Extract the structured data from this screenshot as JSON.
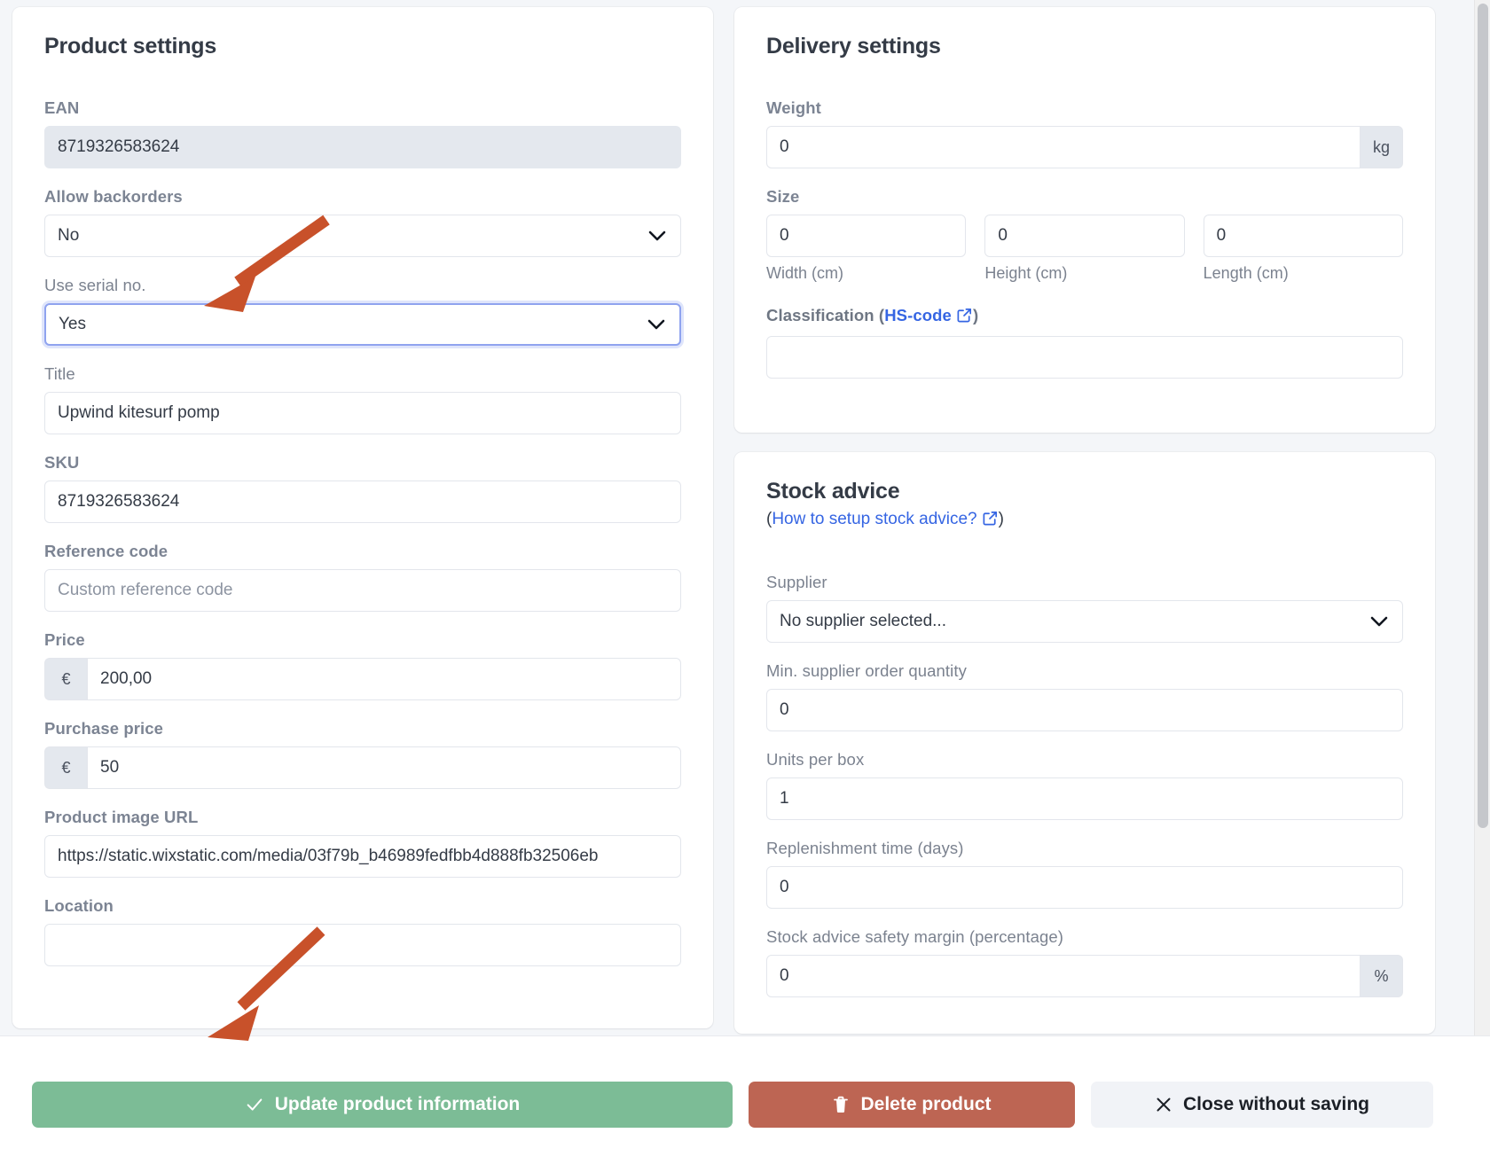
{
  "product_settings": {
    "title": "Product settings",
    "fields": {
      "ean": {
        "label": "EAN",
        "value": "8719326583624"
      },
      "allow_backorders": {
        "label": "Allow backorders",
        "value": "No"
      },
      "use_serial_no": {
        "label": "Use serial no.",
        "value": "Yes"
      },
      "title": {
        "label": "Title",
        "value": "Upwind kitesurf pomp"
      },
      "sku": {
        "label": "SKU",
        "value": "8719326583624"
      },
      "reference_code": {
        "label": "Reference code",
        "value": "",
        "placeholder": "Custom reference code"
      },
      "price": {
        "label": "Price",
        "currency": "€",
        "value": "200,00"
      },
      "purchase_price": {
        "label": "Purchase price",
        "currency": "€",
        "value": "50"
      },
      "product_image_url": {
        "label": "Product image URL",
        "value": "https://static.wixstatic.com/media/03f79b_b46989fedfbb4d888fb32506eb"
      },
      "location": {
        "label": "Location",
        "value": ""
      }
    }
  },
  "delivery_settings": {
    "title": "Delivery settings",
    "fields": {
      "weight": {
        "label": "Weight",
        "value": "0",
        "unit": "kg"
      },
      "size": {
        "label": "Size",
        "inputs": [
          {
            "value": "0",
            "caption": "Width (cm)"
          },
          {
            "value": "0",
            "caption": "Height (cm)"
          },
          {
            "value": "0",
            "caption": "Length (cm)"
          }
        ]
      },
      "classification": {
        "label_prefix": "Classification (",
        "link_text": "HS-code",
        "label_suffix": ")",
        "value": ""
      }
    }
  },
  "stock_advice": {
    "title": "Stock advice",
    "help_prefix": "(",
    "help_link": "How to setup stock advice?",
    "help_suffix": ")",
    "fields": {
      "supplier": {
        "label": "Supplier",
        "value": "No supplier selected..."
      },
      "min_order_qty": {
        "label": "Min. supplier order quantity",
        "value": "0"
      },
      "units_per_box": {
        "label": "Units per box",
        "value": "1"
      },
      "replenishment_time": {
        "label": "Replenishment time (days)",
        "value": "0"
      },
      "safety_margin": {
        "label": "Stock advice safety margin (percentage)",
        "value": "0",
        "unit": "%"
      }
    }
  },
  "actions": {
    "update": {
      "label": "Update product information",
      "icon": "check-icon"
    },
    "delete": {
      "label": "Delete product",
      "icon": "trash-icon"
    },
    "close": {
      "label": "Close without saving",
      "icon": "close-icon"
    }
  },
  "colors": {
    "update_green": "#7cbc96",
    "delete_red": "#bd6553",
    "close_grey": "#f1f3f7",
    "link_blue": "#3565e3",
    "annotation_orange": "#c8512a",
    "focus_border": "#8fa3ef"
  }
}
